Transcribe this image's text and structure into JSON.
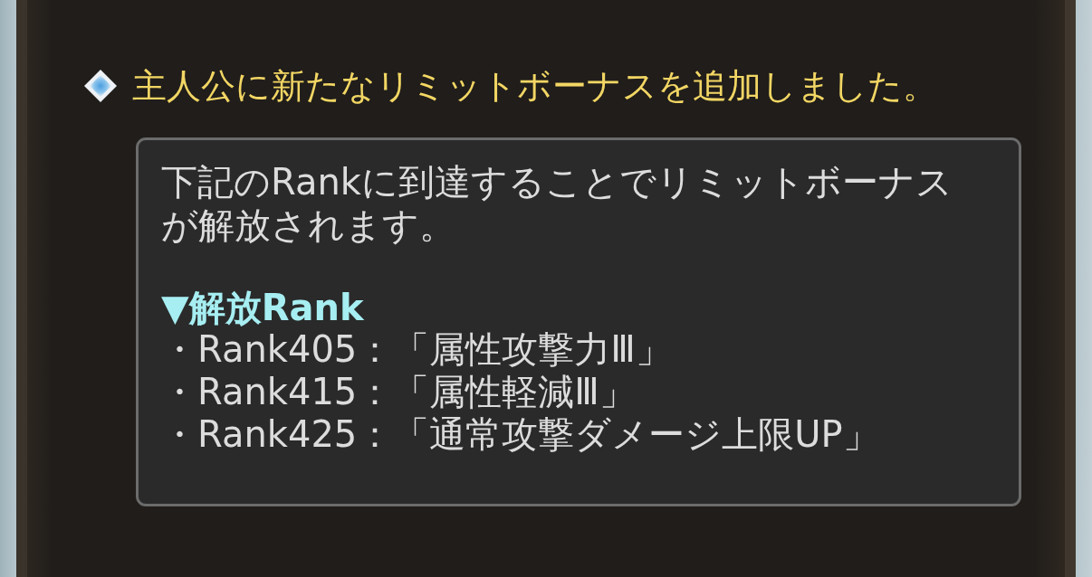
{
  "notice": {
    "title": "主人公に新たなリミットボーナスを追加しました。",
    "message": "下記のRankに到達することでリミットボーナスが解放されます。",
    "section_heading": "▼解放Rank",
    "items": [
      "・Rank405：「属性攻撃力Ⅲ」",
      "・Rank415：「属性軽減Ⅲ」",
      "・Rank425：「通常攻撃ダメージ上限UP」"
    ]
  }
}
